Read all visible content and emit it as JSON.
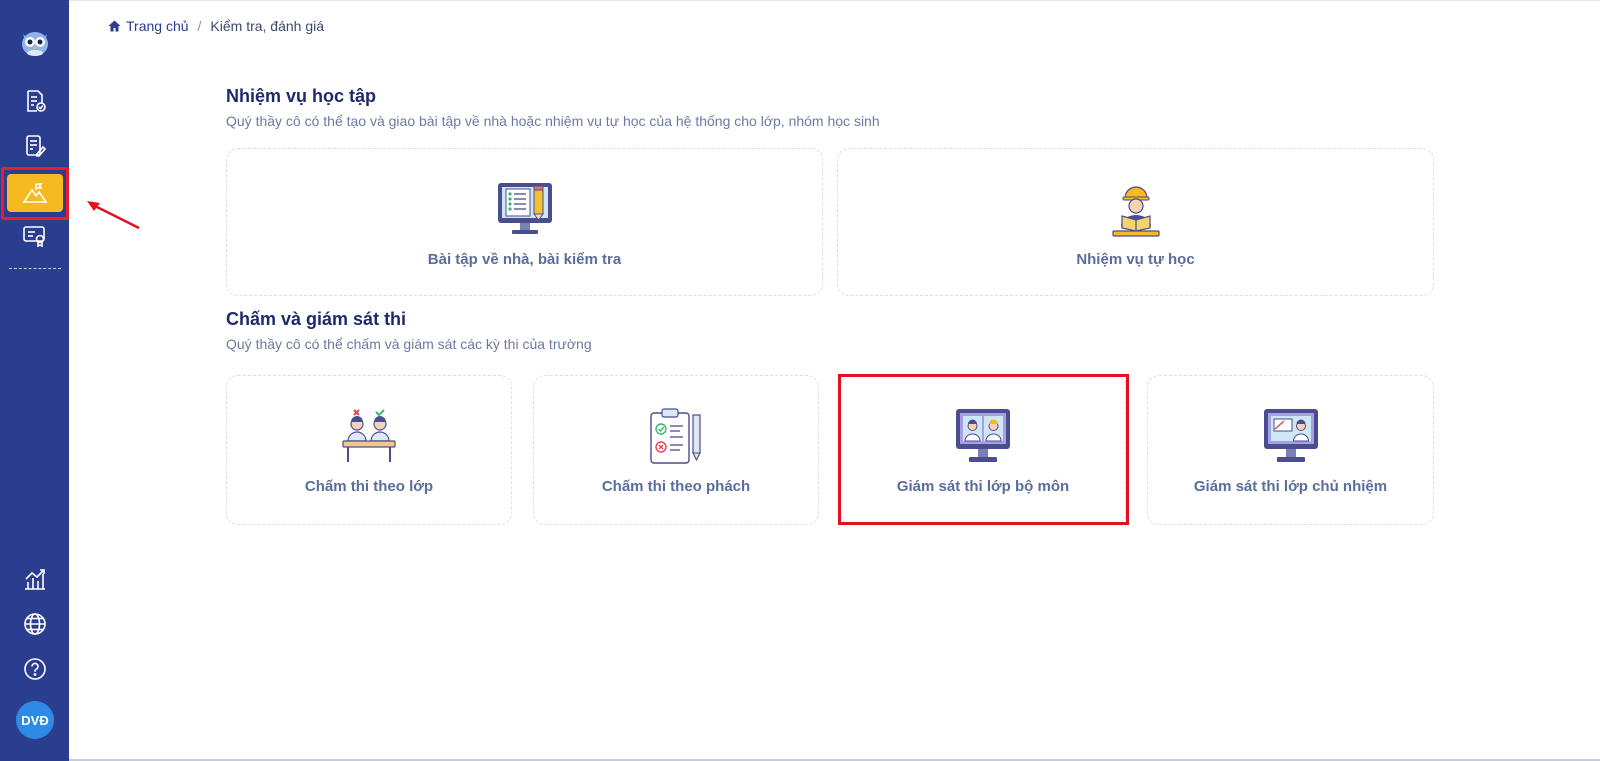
{
  "sidebar": {
    "logo": "owl-logo-icon",
    "items": [
      {
        "icon": "document-check-icon"
      },
      {
        "icon": "document-edit-icon"
      },
      {
        "icon": "exam-mountain-flag-icon",
        "active": true
      },
      {
        "icon": "certificate-icon"
      }
    ],
    "bottom_items": [
      {
        "icon": "chart-icon"
      },
      {
        "icon": "globe-icon"
      },
      {
        "icon": "help-icon"
      }
    ],
    "avatar_initials": "DVĐ",
    "active_color": "#f6b91f",
    "background": "#2b3d8f"
  },
  "breadcrumb": {
    "home": "Trang chủ",
    "separator": "/",
    "current": "Kiểm tra, đánh giá"
  },
  "sections": [
    {
      "title": "Nhiệm vụ học tập",
      "subtitle": "Quý thầy cô có thể tạo và giao bài tập về nhà hoặc nhiệm vụ tự học của hệ thống cho lớp, nhóm học sinh",
      "cards": [
        {
          "label": "Bài tập về nhà, bài kiểm tra",
          "icon": "monitor-checklist-icon"
        },
        {
          "label": "Nhiệm vụ tự học",
          "icon": "student-reading-icon"
        }
      ]
    },
    {
      "title": "Chấm và giám sát thi",
      "subtitle": "Quý thầy cô có thể chấm và giám sát các kỳ thi của trường",
      "cards": [
        {
          "label": "Chấm thi theo lớp",
          "icon": "students-desk-icon"
        },
        {
          "label": "Chấm thi theo phách",
          "icon": "clipboard-pencil-icon"
        },
        {
          "label": "Giám sát thi lớp bộ môn",
          "icon": "monitor-students-icon",
          "highlighted": true
        },
        {
          "label": "Giám sát thi lớp chủ nhiệm",
          "icon": "monitor-classroom-icon"
        }
      ]
    }
  ],
  "colors": {
    "accent": "#2b3d8f",
    "highlight": "#e3111d",
    "title": "#1f2a6e",
    "card_label": "#5b6d9a"
  }
}
